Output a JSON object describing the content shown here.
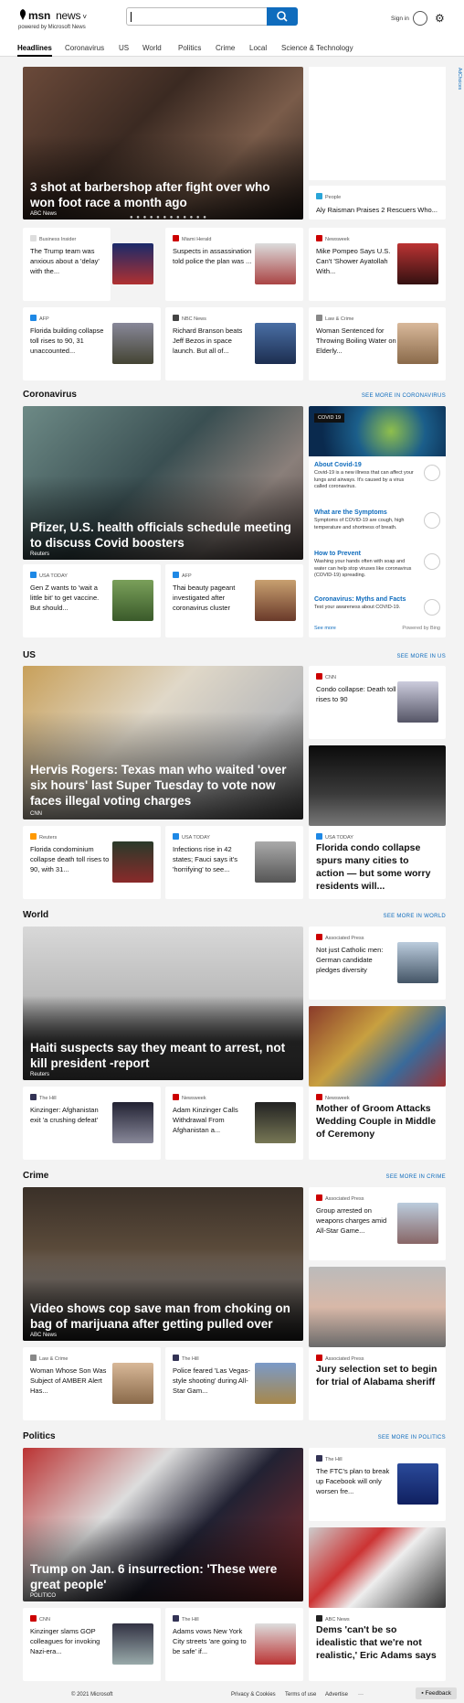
{
  "header": {
    "brand": "msn",
    "product": "news",
    "powered": "powered by Microsoft News",
    "signin": "Sign in"
  },
  "nav": [
    "Headlines",
    "Coronavirus",
    "US",
    "World",
    "Politics",
    "Crime",
    "Local",
    "Science & Technology"
  ],
  "ad_label": "AdChoices",
  "headlines": {
    "hero": {
      "title": "3 shot at barbershop after fight over who won foot race a month ago",
      "source": "ABC News"
    },
    "side": {
      "source": "People",
      "title": "Aly Raisman Praises 2 Rescuers Who..."
    },
    "cards": [
      {
        "source": "Business Insider",
        "title": "The Trump team was anxious about a 'delay' with the..."
      },
      {
        "source": "Miami Herald",
        "title": "Suspects in assassination told police the plan was ..."
      },
      {
        "source": "Newsweek",
        "title": "Mike Pompeo Says U.S. Can't 'Shower Ayatollah With..."
      },
      {
        "source": "AFP",
        "title": "Florida building collapse toll rises to 90, 31 unaccounted..."
      },
      {
        "source": "NBC News",
        "title": "Richard Branson beats Jeff Bezos in space launch. But all of..."
      },
      {
        "source": "Law & Crime",
        "title": "Woman Sentenced for Throwing Boiling Water on Elderly..."
      }
    ]
  },
  "coronavirus": {
    "title": "Coronavirus",
    "see_more": "SEE MORE IN CORONAVIRUS",
    "hero": {
      "title": "Pfizer, U.S. health officials schedule meeting to discuss Covid boosters",
      "source": "Reuters"
    },
    "cards": [
      {
        "source": "USA TODAY",
        "title": "Gen Z wants to 'wait a little bit' to get vaccine. But should..."
      },
      {
        "source": "AFP",
        "title": "Thai beauty pageant investigated after coronavirus cluster"
      }
    ],
    "panel": {
      "tag": "COVID 19",
      "items": [
        {
          "h": "About Covid-19",
          "t": "Covid-19 is a new illness that can affect your lungs and airways. It's caused by a virus called coronavirus."
        },
        {
          "h": "What are the Symptoms",
          "t": "Symptoms of COVID-19 are cough, high temperature and shortness of breath."
        },
        {
          "h": "How to Prevent",
          "t": "Washing your hands often with soap and water can help stop viruses like coronavirus (COVID-19) spreading."
        },
        {
          "h": "Coronavirus: Myths and Facts",
          "t": "Test your awareness about COVID-19."
        }
      ],
      "see_more": "See more",
      "powered": "Powered by Bing"
    }
  },
  "us": {
    "title": "US",
    "see_more": "SEE MORE IN US",
    "hero": {
      "title": "Hervis Rogers: Texas man who waited 'over six hours' last Super Tuesday to vote now faces illegal voting charges",
      "source": "CNN"
    },
    "side": {
      "source": "CNN",
      "title": "Condo collapse: Death toll rises to 90"
    },
    "side2": {
      "source": "USA TODAY",
      "title": "Florida condo collapse spurs many cities to action — but some worry residents will..."
    },
    "cards": [
      {
        "source": "Reuters",
        "title": "Florida condominium collapse death toll rises to 90, with 31..."
      },
      {
        "source": "USA TODAY",
        "title": "Infections rise in 42 states; Fauci says it's 'horrifying' to see..."
      }
    ]
  },
  "world": {
    "title": "World",
    "see_more": "SEE MORE IN WORLD",
    "hero": {
      "title": "Haiti suspects say they meant to arrest, not kill president -report",
      "source": "Reuters"
    },
    "side": {
      "source": "Associated Press",
      "title": "Not just Catholic men: German candidate pledges diversity"
    },
    "side2": {
      "source": "Newsweek",
      "title": "Mother of Groom Attacks Wedding Couple in Middle of Ceremony"
    },
    "cards": [
      {
        "source": "The Hill",
        "title": "Kinzinger: Afghanistan exit 'a crushing defeat'"
      },
      {
        "source": "Newsweek",
        "title": "Adam Kinzinger Calls Withdrawal From Afghanistan a..."
      }
    ]
  },
  "crime": {
    "title": "Crime",
    "see_more": "SEE MORE IN CRIME",
    "hero": {
      "title": "Video shows cop save man from choking on bag of marijuana after getting pulled over",
      "source": "ABC News"
    },
    "side": {
      "source": "Associated Press",
      "title": "Group arrested on weapons charges amid All-Star Game..."
    },
    "side2": {
      "source": "Associated Press",
      "title": "Jury selection set to begin for trial of Alabama sheriff"
    },
    "cards": [
      {
        "source": "Law & Crime",
        "title": "Woman Whose Son Was Subject of AMBER Alert Has..."
      },
      {
        "source": "The Hill",
        "title": "Police feared 'Las Vegas-style shooting' during All-Star Gam..."
      }
    ]
  },
  "politics": {
    "title": "Politics",
    "see_more": "SEE MORE IN POLITICS",
    "hero": {
      "title": "Trump on Jan. 6 insurrection: 'These were great people'",
      "source": "POLITICO"
    },
    "side": {
      "source": "The Hill",
      "title": "The FTC's plan to break up Facebook will only worsen fre..."
    },
    "side2": {
      "source": "ABC News",
      "title": "Dems 'can't be so idealistic that we're not realistic,' Eric Adams says"
    },
    "cards": [
      {
        "source": "CNN",
        "title": "Kinzinger slams GOP colleagues for invoking Nazi-era..."
      },
      {
        "source": "The Hill",
        "title": "Adams vows New York City streets 'are going to be safe' if..."
      }
    ]
  },
  "footer": {
    "copyright": "© 2021 Microsoft",
    "privacy": "Privacy & Cookies",
    "terms": "Terms of use",
    "advertise": "Advertise",
    "more": "···",
    "feedback": "Feedback"
  }
}
